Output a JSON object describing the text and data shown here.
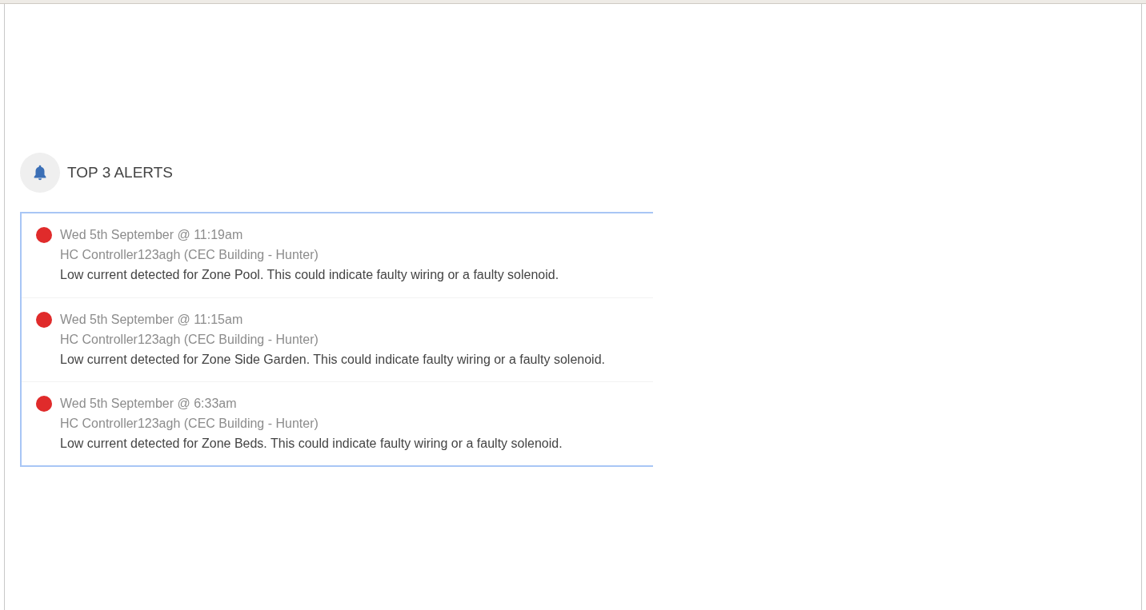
{
  "header": {
    "title": "TOP 3 ALERTS"
  },
  "alerts": [
    {
      "color": "#e02b2b",
      "time": "Wed 5th September @ 11:19am",
      "source": "HC Controller123agh (CEC Building - Hunter)",
      "message": "Low current detected for Zone Pool. This could indicate faulty wiring or a faulty solenoid."
    },
    {
      "color": "#e02b2b",
      "time": "Wed 5th September @ 11:15am",
      "source": "HC Controller123agh (CEC Building - Hunter)",
      "message": "Low current detected for Zone Side Garden. This could indicate faulty wiring or a faulty solenoid."
    },
    {
      "color": "#e02b2b",
      "time": "Wed 5th September @ 6:33am",
      "source": "HC Controller123agh (CEC Building - Hunter)",
      "message": "Low current detected for Zone Beds. This could indicate faulty wiring or a faulty solenoid."
    }
  ]
}
